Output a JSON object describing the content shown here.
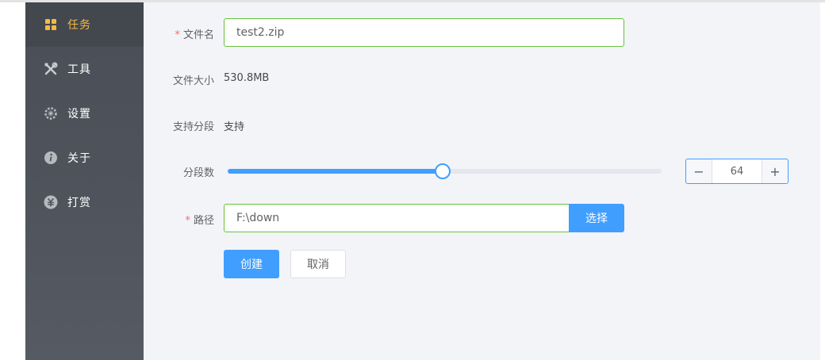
{
  "colors": {
    "active_accent": "#f4b942",
    "primary": "#409eff",
    "valid_border": "#67c23a",
    "required": "#f56c6c"
  },
  "sidebar": {
    "items": [
      {
        "label": "任务",
        "icon": "grid-icon",
        "active": true
      },
      {
        "label": "工具",
        "icon": "tools-icon",
        "active": false
      },
      {
        "label": "设置",
        "icon": "gear-icon",
        "active": false
      },
      {
        "label": "关于",
        "icon": "info-icon",
        "active": false
      },
      {
        "label": "打赏",
        "icon": "yuan-icon",
        "active": false
      }
    ]
  },
  "form": {
    "filename": {
      "label": "文件名",
      "required_mark": "*",
      "value": "test2.zip"
    },
    "filesize": {
      "label": "文件大小",
      "value": "530.8MB"
    },
    "segment_support": {
      "label": "支持分段",
      "value": "支持"
    },
    "segments": {
      "label": "分段数",
      "value": "64",
      "slider_fraction": 0.495,
      "minus": "−",
      "plus": "+"
    },
    "path": {
      "label": "路径",
      "required_mark": "*",
      "value": "F:\\down",
      "choose_button": "选择"
    },
    "create_button": "创建",
    "cancel_button": "取消"
  }
}
